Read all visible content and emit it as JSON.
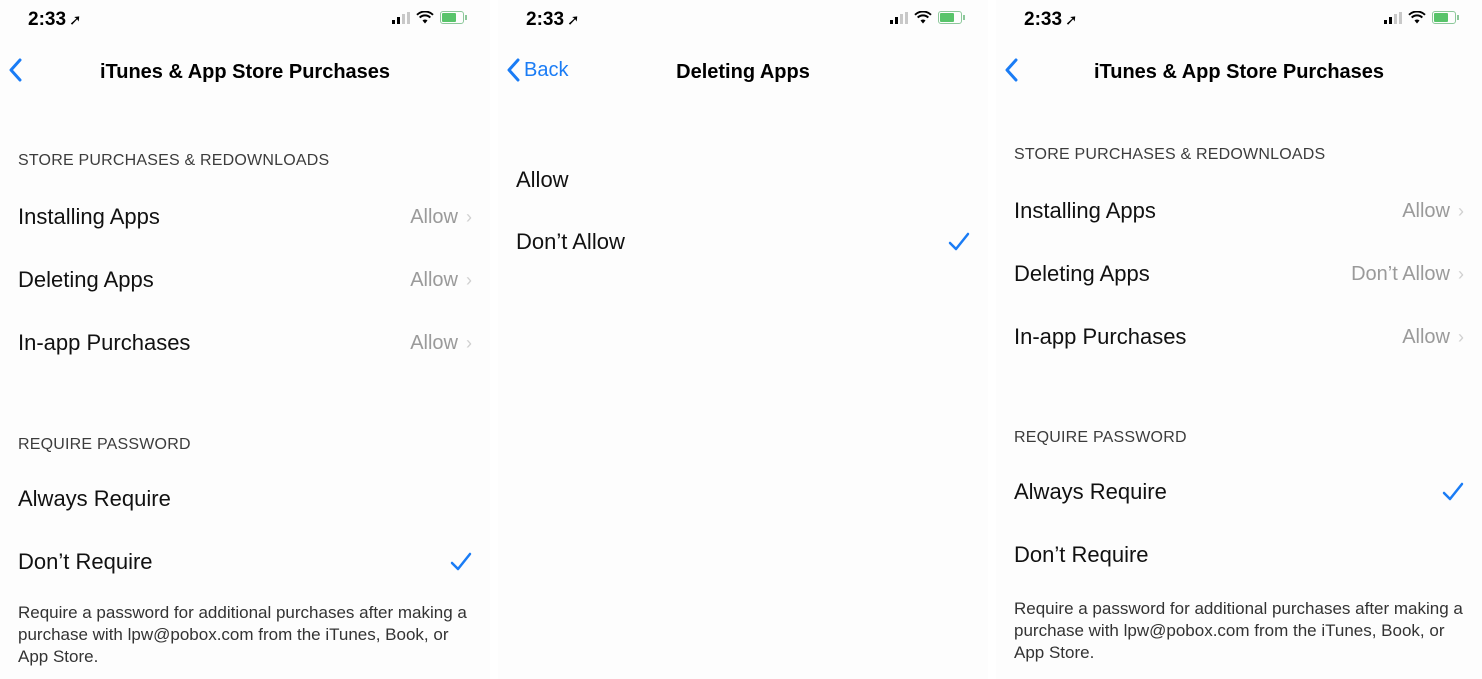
{
  "colors": {
    "accent": "#1a7cf5",
    "value_gray": "#9a9a9a"
  },
  "status_bar": {
    "time": "2:33"
  },
  "panel1": {
    "back_label": "",
    "title": "iTunes & App Store Purchases",
    "section1": "STORE PURCHASES & REDOWNLOADS",
    "rows": [
      {
        "label": "Installing Apps",
        "value": "Allow"
      },
      {
        "label": "Deleting Apps",
        "value": "Allow"
      },
      {
        "label": "In-app Purchases",
        "value": "Allow"
      }
    ],
    "section2": "REQUIRE PASSWORD",
    "options": [
      {
        "label": "Always Require",
        "checked": false
      },
      {
        "label": "Don’t Require",
        "checked": true
      }
    ],
    "footer": "Require a password for additional purchases after making a purchase with lpw@pobox.com from the iTunes, Book, or App Store."
  },
  "panel2": {
    "back_label": "Back",
    "title": "Deleting Apps",
    "options": [
      {
        "label": "Allow",
        "checked": false
      },
      {
        "label": "Don’t Allow",
        "checked": true
      }
    ]
  },
  "panel3": {
    "back_label": "",
    "title": "iTunes & App Store Purchases",
    "section1": "STORE PURCHASES & REDOWNLOADS",
    "rows": [
      {
        "label": "Installing Apps",
        "value": "Allow"
      },
      {
        "label": "Deleting Apps",
        "value": "Don’t Allow"
      },
      {
        "label": "In-app Purchases",
        "value": "Allow"
      }
    ],
    "section2": "REQUIRE PASSWORD",
    "options": [
      {
        "label": "Always Require",
        "checked": true
      },
      {
        "label": "Don’t Require",
        "checked": false
      }
    ],
    "footer": "Require a password for additional purchases after making a purchase with lpw@pobox.com from the iTunes, Book, or App Store."
  }
}
